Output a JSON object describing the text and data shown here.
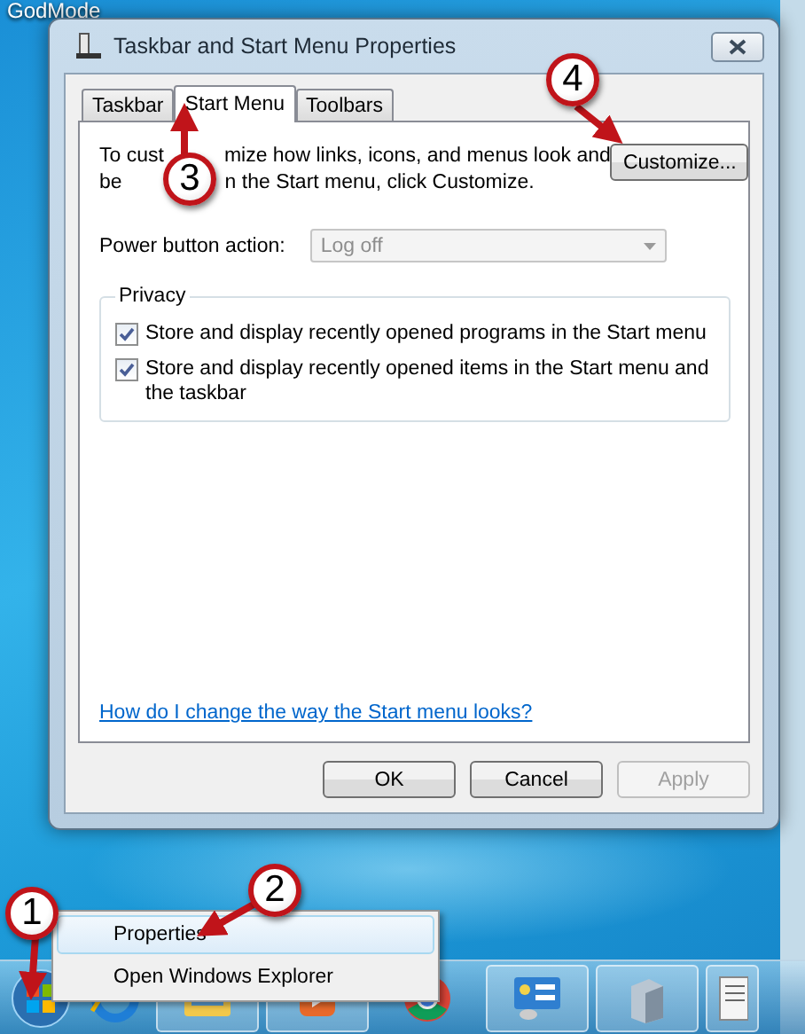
{
  "desktop": {
    "icon_label": "GodMode"
  },
  "window": {
    "title": "Taskbar and Start Menu Properties",
    "tabs": [
      {
        "label": "Taskbar",
        "selected": false
      },
      {
        "label": "Start Menu",
        "selected": true
      },
      {
        "label": "Toolbars",
        "selected": false
      }
    ],
    "intro": {
      "line_1": [
        "To cust",
        "mize how links, icons, and menus look and"
      ],
      "line_2": [
        "be",
        "n the Start menu, click Customize."
      ]
    },
    "customize_button": "Customize...",
    "power_button": {
      "label": "Power button action:",
      "value": "Log off",
      "disabled": true
    },
    "privacy": {
      "title": "Privacy",
      "options": [
        {
          "label": "Store and display recently opened programs in the Start menu",
          "checked": true
        },
        {
          "label": "Store and display recently opened items in the Start menu and the taskbar",
          "checked": true
        }
      ]
    },
    "help_link": "How do I change the way the Start menu looks?",
    "buttons": [
      {
        "label": "OK",
        "disabled": false
      },
      {
        "label": "Cancel",
        "disabled": false
      },
      {
        "label": "Apply",
        "disabled": true
      }
    ]
  },
  "context_menu": {
    "items": [
      {
        "label": "Properties",
        "selected": true
      },
      {
        "label": "Open Windows Explorer",
        "selected": false
      }
    ]
  },
  "callouts": [
    "1",
    "2",
    "3",
    "4"
  ]
}
